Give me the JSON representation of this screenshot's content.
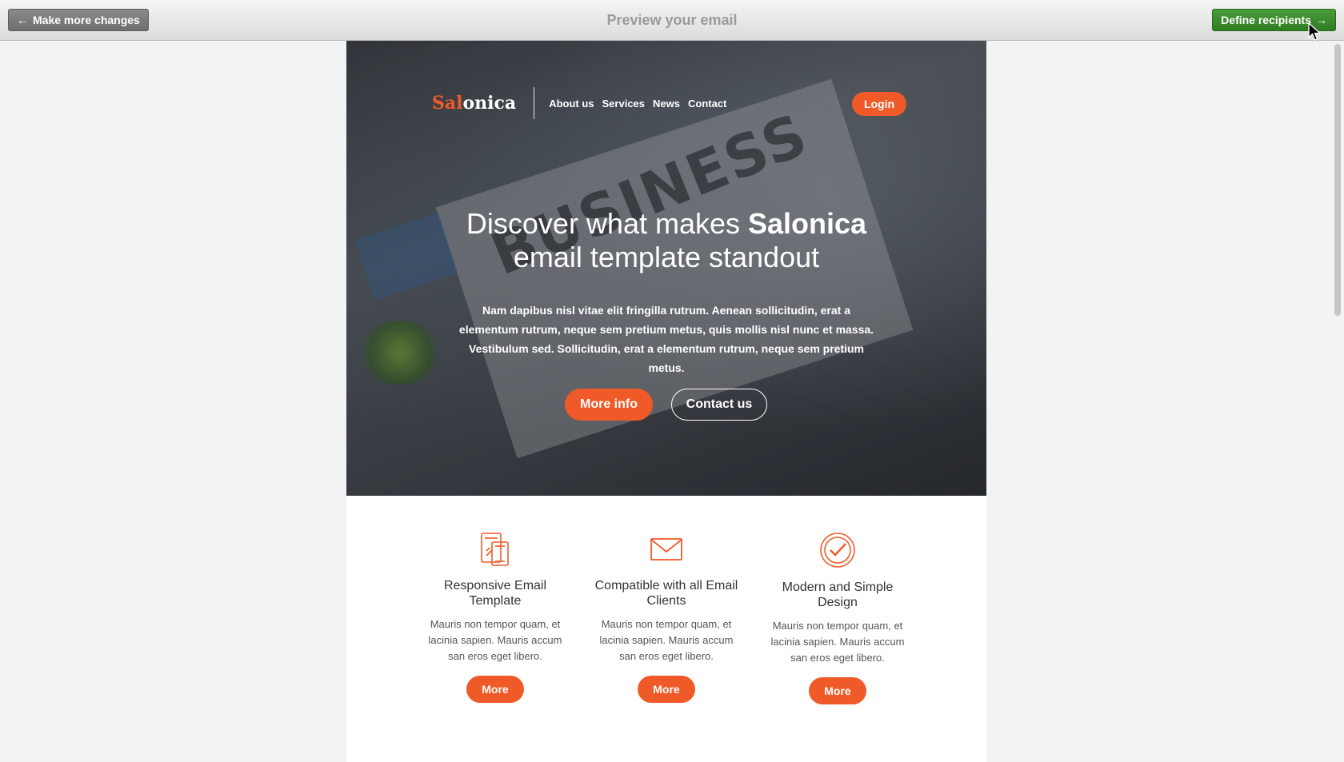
{
  "toolbar": {
    "back_label": "Make more changes",
    "title": "Preview your email",
    "next_label": "Define recipients"
  },
  "email": {
    "logo": {
      "accent": "Sal",
      "rest": "onica"
    },
    "nav": [
      {
        "label": "About us"
      },
      {
        "label": "Services"
      },
      {
        "label": "News"
      },
      {
        "label": "Contact"
      }
    ],
    "login_label": "Login",
    "hero": {
      "headline_part1": "Discover what makes ",
      "headline_bold": "Salonica",
      "headline_part2": "email template standout",
      "intro": "Nam dapibus nisl vitae elit fringilla rutrum. Aenean sollicitudin, erat a elementum rutrum, neque sem pretium metus, quis mollis nisl nunc et massa. Vestibulum sed. Sollicitudin, erat a elementum rutrum, neque sem pretium metus.",
      "primary_cta": "More info",
      "secondary_cta": "Contact us"
    },
    "features": [
      {
        "icon": "responsive-devices-icon",
        "title": "Responsive Email Template",
        "text": "Mauris non tempor quam, et lacinia sapien. Mauris accum san eros eget libero.",
        "button": "More"
      },
      {
        "icon": "envelope-icon",
        "title": "Compatible with all Email Clients",
        "text": "Mauris non tempor quam, et lacinia sapien. Mauris accum san eros eget libero.",
        "button": "More"
      },
      {
        "icon": "check-circle-icon",
        "title": "Modern and Simple Design",
        "text": "Mauris non tempor quam, et lacinia sapien. Mauris accum san eros eget libero.",
        "button": "More"
      }
    ]
  },
  "colors": {
    "accent": "#f05a28",
    "next_button": "#3a8c2c",
    "back_button": "#7a7a7a"
  }
}
